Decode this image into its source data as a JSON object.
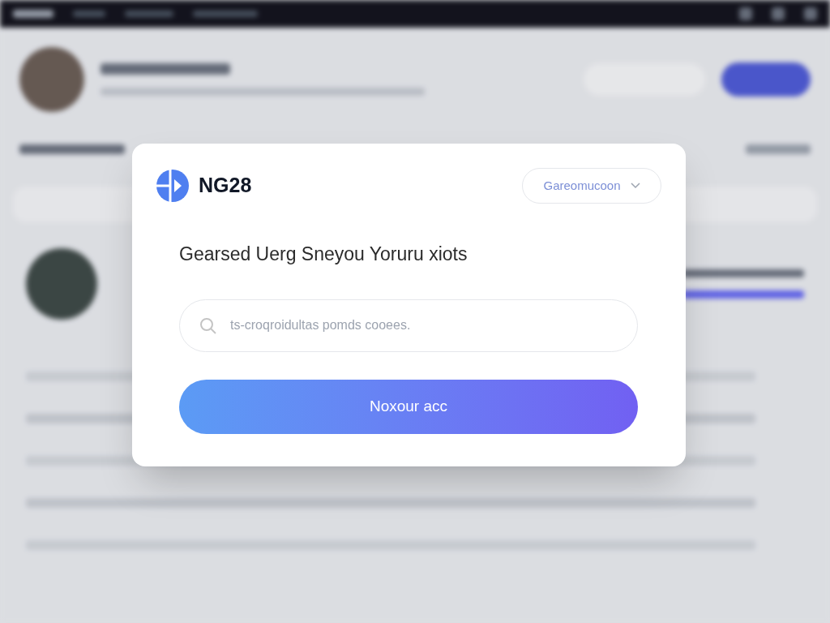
{
  "dialog": {
    "brand": "NG28",
    "dropdown": {
      "label": "Gareomucoon"
    },
    "heading": "Gearsed Uerg Sneyou Yoruru xiots",
    "search": {
      "placeholder": "ts-croqroidultas pomds cooees."
    },
    "button": "Noxour acc"
  }
}
